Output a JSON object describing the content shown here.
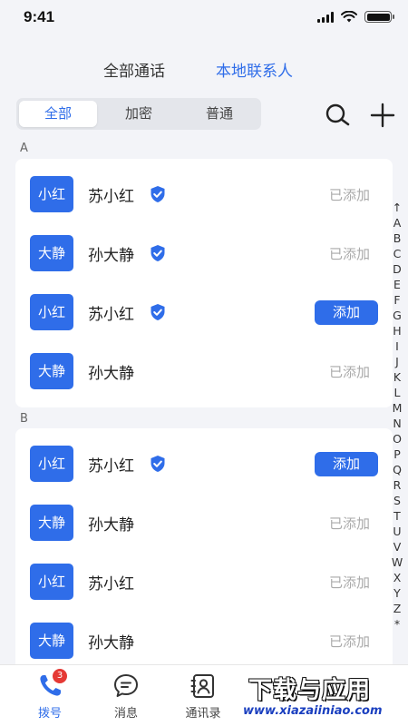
{
  "status_bar": {
    "time": "9:41"
  },
  "top_tabs": [
    {
      "label": "全部通话",
      "active": false
    },
    {
      "label": "本地联系人",
      "active": true
    }
  ],
  "segments": [
    {
      "label": "全部",
      "active": true
    },
    {
      "label": "加密",
      "active": false
    },
    {
      "label": "普通",
      "active": false
    }
  ],
  "toolbar": {
    "search_icon": "search-icon",
    "add_icon": "plus-icon"
  },
  "sections": [
    {
      "letter": "A",
      "contacts": [
        {
          "avatar": "小红",
          "name": "苏小红",
          "verified": true,
          "status": "已添加"
        },
        {
          "avatar": "大静",
          "name": "孙大静",
          "verified": true,
          "status": "已添加"
        },
        {
          "avatar": "小红",
          "name": "苏小红",
          "verified": true,
          "status": "添加"
        },
        {
          "avatar": "大静",
          "name": "孙大静",
          "verified": false,
          "status": "已添加"
        }
      ]
    },
    {
      "letter": "B",
      "contacts": [
        {
          "avatar": "小红",
          "name": "苏小红",
          "verified": true,
          "status": "添加"
        },
        {
          "avatar": "大静",
          "name": "孙大静",
          "verified": false,
          "status": "已添加"
        },
        {
          "avatar": "小红",
          "name": "苏小红",
          "verified": false,
          "status": "已添加"
        },
        {
          "avatar": "大静",
          "name": "孙大静",
          "verified": false,
          "status": "已添加"
        }
      ]
    }
  ],
  "index_letters": [
    "↑",
    "A",
    "B",
    "C",
    "D",
    "E",
    "F",
    "G",
    "H",
    "I",
    "J",
    "K",
    "L",
    "M",
    "N",
    "O",
    "P",
    "Q",
    "R",
    "S",
    "T",
    "U",
    "V",
    "W",
    "X",
    "Y",
    "Z",
    "*"
  ],
  "bottom_nav": [
    {
      "label": "拨号",
      "icon": "phone-icon",
      "badge": "3",
      "active": true
    },
    {
      "label": "消息",
      "icon": "message-icon",
      "active": false
    },
    {
      "label": "通讯录",
      "icon": "contacts-icon",
      "active": false
    }
  ],
  "watermark": {
    "title": "下载与应用",
    "url": "www.xiazaiiniao.com"
  },
  "colors": {
    "accent": "#2f6de9",
    "background": "#f3f4f8",
    "muted_text": "#aaaaaa",
    "badge": "#e53935"
  }
}
